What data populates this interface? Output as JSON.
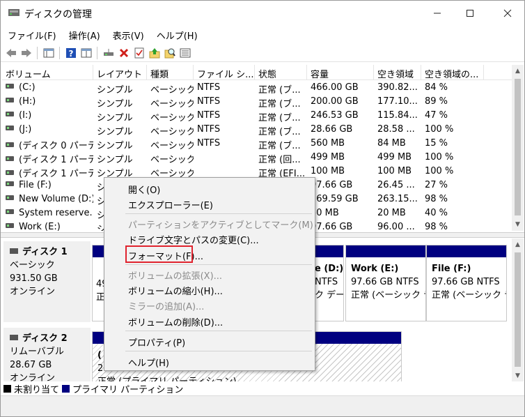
{
  "window": {
    "title": "ディスクの管理"
  },
  "menu": [
    "ファイル(F)",
    "操作(A)",
    "表示(V)",
    "ヘルプ(H)"
  ],
  "toolbar": {
    "icons": [
      "back-icon",
      "forward-icon",
      "properties-icon",
      "help-icon",
      "console-tree-icon",
      "connect-icon",
      "delete-icon",
      "check-icon",
      "import-icon",
      "search-icon",
      "list-icon"
    ]
  },
  "volume_list": {
    "columns": [
      "ボリューム",
      "レイアウト",
      "種類",
      "ファイル シ...",
      "状態",
      "容量",
      "空き領域",
      "空き領域の..."
    ],
    "rows": [
      [
        "(C:)",
        "シンプル",
        "ベーシック",
        "NTFS",
        "正常 (ブ...",
        "466.00 GB",
        "390.82...",
        "84 %"
      ],
      [
        "(H:)",
        "シンプル",
        "ベーシック",
        "NTFS",
        "正常 (ブ...",
        "200.00 GB",
        "177.10...",
        "89 %"
      ],
      [
        "(I:)",
        "シンプル",
        "ベーシック",
        "NTFS",
        "正常 (ブ...",
        "246.53 GB",
        "115.84...",
        "47 %"
      ],
      [
        "(J:)",
        "シンプル",
        "ベーシック",
        "NTFS",
        "正常 (ブ...",
        "28.66 GB",
        "28.58 ...",
        "100 %"
      ],
      [
        "(ディスク 0 パーテ...",
        "シンプル",
        "ベーシック",
        "NTFS",
        "正常 (ブ...",
        "560 MB",
        "84 MB",
        "15 %"
      ],
      [
        "(ディスク 1 パーテ...",
        "シンプル",
        "ベーシック",
        "",
        "正常 (回...",
        "499 MB",
        "499 MB",
        "100 %"
      ],
      [
        "(ディスク 1 パーテ...",
        "シンプル",
        "ベーシック",
        "",
        "正常 (EFI...",
        "100 MB",
        "100 MB",
        "100 %"
      ],
      [
        "File (F:)",
        "シ",
        "",
        "",
        "",
        "97.66 GB",
        "26.45 ...",
        "27 %"
      ],
      [
        "New Volume (D:)",
        "シ",
        "",
        "",
        "",
        "269.59 GB",
        "263.15...",
        "98 %"
      ],
      [
        "System reserve...",
        "シ",
        "",
        "",
        "",
        "50 MB",
        "20 MB",
        "40 %"
      ],
      [
        "Work (E:)",
        "シ",
        "",
        "",
        "",
        "97.66 GB",
        "96.00 ...",
        "98 %"
      ]
    ]
  },
  "disks": [
    {
      "title": "ディスク 1",
      "lines": [
        "ベーシック",
        "931.50 GB",
        "オンライン"
      ],
      "partitions": [
        {
          "name": "",
          "lines": [
            "49",
            "正"
          ]
        },
        {
          "name": "e (D:)",
          "lines": [
            "NTFS",
            "ク デー"
          ]
        },
        {
          "name": "Work (E:)",
          "lines": [
            "97.66 GB NTFS",
            "正常 (ベーシック デ"
          ]
        },
        {
          "name": "File (F:)",
          "lines": [
            "97.66 GB NTFS",
            "正常 (ベーシック デ"
          ]
        }
      ]
    },
    {
      "title": "ディスク 2",
      "lines": [
        "リムーバブル",
        "28.67 GB",
        "オンライン"
      ],
      "partitions": [
        {
          "name": "(",
          "lines": [
            "28.66 GB NTFS",
            "正常 (プライマリ パーティション)"
          ]
        }
      ]
    }
  ],
  "legend": [
    {
      "label": "未割り当て",
      "color": "#000000"
    },
    {
      "label": "プライマリ パーティション",
      "color": "#000080"
    }
  ],
  "context_menu": {
    "items": [
      {
        "label": "開く(O)",
        "enabled": true
      },
      {
        "label": "エクスプローラー(E)",
        "enabled": true
      },
      {
        "label": "パーティションをアクティブとしてマーク(M)",
        "enabled": false
      },
      {
        "label": "ドライブ文字とパスの変更(C)...",
        "enabled": true
      },
      {
        "label": "フォーマット(F)...",
        "enabled": true,
        "highlighted": true
      },
      {
        "label": "ボリュームの拡張(X)...",
        "enabled": false
      },
      {
        "label": "ボリュームの縮小(H)...",
        "enabled": true
      },
      {
        "label": "ミラーの追加(A)...",
        "enabled": false
      },
      {
        "label": "ボリュームの削除(D)...",
        "enabled": true
      },
      {
        "label": "プロパティ(P)",
        "enabled": true
      },
      {
        "label": "ヘルプ(H)",
        "enabled": true
      }
    ]
  },
  "colors": {
    "primary_partition": "#000080",
    "highlight_box": "#e0232e",
    "delete_icon": "#d0201a"
  }
}
